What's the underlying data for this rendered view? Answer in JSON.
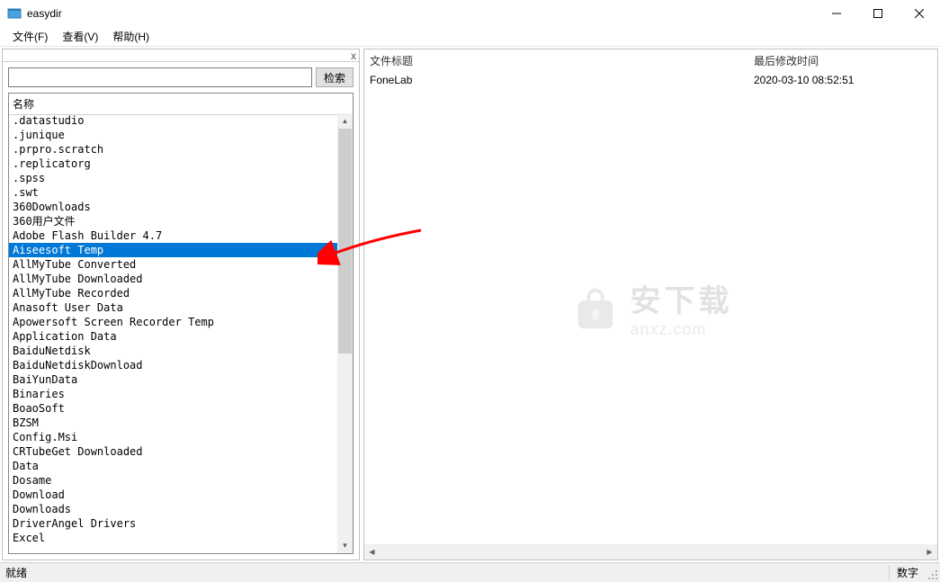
{
  "window": {
    "title": "easydir"
  },
  "menu": {
    "file": "文件(F)",
    "view": "查看(V)",
    "help": "帮助(H)"
  },
  "left": {
    "close_x": "x",
    "search_button": "检索",
    "list_header": "名称",
    "items": [
      ".datastudio",
      ".junique",
      ".prpro.scratch",
      ".replicatorg",
      ".spss",
      ".swt",
      "360Downloads",
      "360用户文件",
      "Adobe Flash Builder 4.7",
      "Aiseesoft Temp",
      "AllMyTube Converted",
      "AllMyTube Downloaded",
      "AllMyTube Recorded",
      "Anasoft User Data",
      "Apowersoft Screen Recorder Temp",
      "Application Data",
      "BaiduNetdisk",
      "BaiduNetdiskDownload",
      "BaiYunData",
      "Binaries",
      "BoaoSoft",
      "BZSM",
      "Config.Msi",
      "CRTubeGet Downloaded",
      "Data",
      "Dosame",
      "Download",
      "Downloads",
      "DriverAngel Drivers",
      "Excel"
    ],
    "selected_index": 9
  },
  "right": {
    "col_title": "文件标题",
    "col_time": "最后修改时间",
    "rows": [
      {
        "title": "FoneLab",
        "time": "2020-03-10 08:52:51"
      }
    ]
  },
  "watermark": {
    "cn": "安下载",
    "en": "anxz.com"
  },
  "status": {
    "left": "就绪",
    "right": "数字"
  }
}
